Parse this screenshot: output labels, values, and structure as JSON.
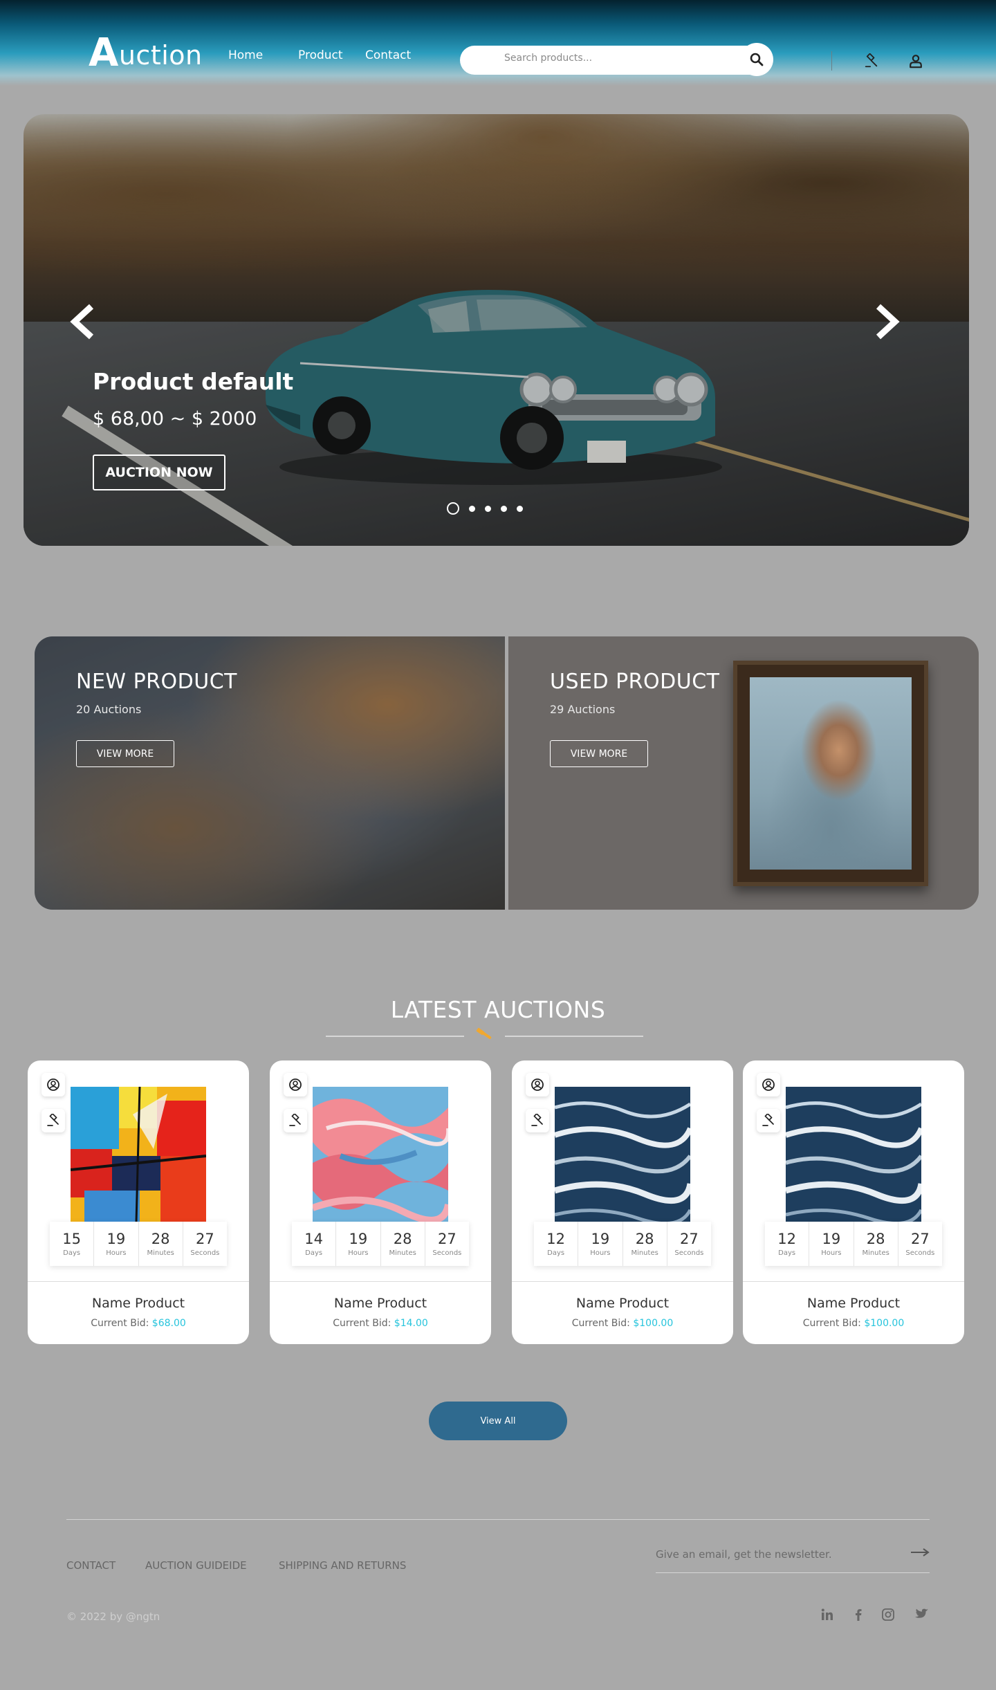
{
  "header": {
    "logo_initial": "A",
    "logo_rest": "uction",
    "nav": [
      "Home",
      "Product",
      "Contact"
    ],
    "search_placeholder": "Search products..."
  },
  "hero": {
    "title": "Product default",
    "price": "$ 68,00 ~ $ 2000",
    "button": "AUCTION NOW",
    "slides": 5,
    "active_slide": 1
  },
  "categories": [
    {
      "title": "NEW PRODUCT",
      "count": "20 Auctions",
      "button": "VIEW MORE"
    },
    {
      "title": "USED PRODUCT",
      "count": "29 Auctions",
      "button": "VIEW MORE"
    }
  ],
  "latest": {
    "title": "LATEST AUCTIONS",
    "labels": {
      "days": "Days",
      "hours": "Hours",
      "minutes": "Minutes",
      "seconds": "Seconds"
    },
    "bid_label": "Current Bid:",
    "cards": [
      {
        "name": "Name Product",
        "bid": "$68.00",
        "days": "15",
        "hours": "19",
        "minutes": "28",
        "seconds": "27"
      },
      {
        "name": "Name Product",
        "bid": "$14.00",
        "days": "14",
        "hours": "19",
        "minutes": "28",
        "seconds": "27"
      },
      {
        "name": "Name Product",
        "bid": "$100.00",
        "days": "12",
        "hours": "19",
        "minutes": "28",
        "seconds": "27"
      },
      {
        "name": "Name Product",
        "bid": "$100.00",
        "days": "12",
        "hours": "19",
        "minutes": "28",
        "seconds": "27"
      }
    ],
    "view_all": "View All"
  },
  "footer": {
    "links": [
      "CONTACT",
      "AUCTION GUIDEIDE",
      "SHIPPING AND RETURNS"
    ],
    "newsletter_placeholder": "Give an email, get the newsletter.",
    "copyright": "© 2022 by @ngtn"
  },
  "colors": {
    "accent": "#26c4dc",
    "button": "#2f6a8f",
    "gavel": "#f0a830"
  }
}
